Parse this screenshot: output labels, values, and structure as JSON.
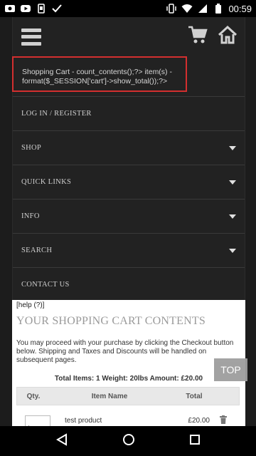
{
  "status_bar": {
    "left_icons": [
      "photo-icon",
      "youtube-icon",
      "screenshot-icon",
      "check-icon"
    ],
    "right_icons": [
      "vibrate-icon",
      "wifi-icon",
      "signal-icon",
      "battery-icon"
    ],
    "time": "00:59"
  },
  "header": {
    "cart_line": "Shopping Cart - count_contents();?> item(s) - format($_SESSION['cart']->show_total());?>"
  },
  "menu": {
    "items": [
      {
        "label": "LOG IN / REGISTER",
        "has_caret": false
      },
      {
        "label": "SHOP",
        "has_caret": true
      },
      {
        "label": "QUICK LINKS",
        "has_caret": true
      },
      {
        "label": "INFO",
        "has_caret": true
      },
      {
        "label": "SEARCH",
        "has_caret": true
      },
      {
        "label": "CONTACT US",
        "has_caret": false
      }
    ]
  },
  "content": {
    "help": "[help (?)]",
    "heading": "YOUR SHOPPING CART CONTENTS",
    "paragraph": "You may proceed with your purchase by clicking the Checkout button below. Shipping and Taxes and Discounts will be handled on subsequent pages.",
    "totals": "Total Items: 1  Weight: 20lbs  Amount: £20.00",
    "table": {
      "headers": [
        "Qty.",
        "Item Name",
        "Total"
      ],
      "rows": [
        {
          "qty": "1",
          "name": "test product",
          "total": "£20.00"
        }
      ]
    }
  },
  "top_button": "TOP"
}
